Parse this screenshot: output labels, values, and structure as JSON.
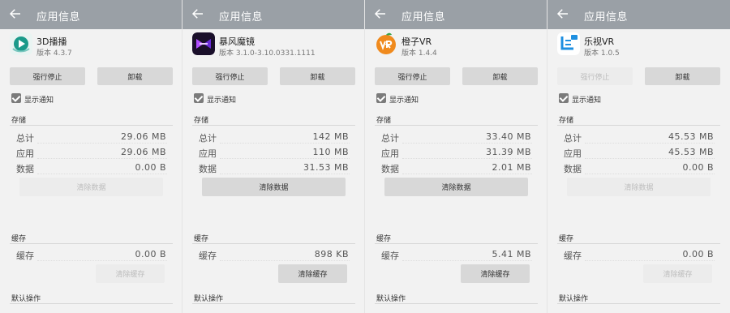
{
  "panels": [
    {
      "header_title": "应用信息",
      "app_name": "3D播播",
      "version": "版本 4.3.7",
      "icon_name": "3d-bobo-app-icon",
      "accent": "#1a9a8a",
      "force_stop": "强行停止",
      "uninstall": "卸载",
      "force_stop_enabled": true,
      "show_notifications": "显示通知",
      "storage_title": "存储",
      "rows": [
        {
          "label": "总计",
          "value": "29.06  MB"
        },
        {
          "label": "应用",
          "value": "29.06  MB"
        },
        {
          "label": "数据",
          "value": "0.00  B"
        }
      ],
      "clear_data": "清除数据",
      "clear_data_enabled": false,
      "cache_title": "缓存",
      "cache_label": "缓存",
      "cache_value": "0.00  B",
      "clear_cache": "清除缓存",
      "clear_cache_enabled": false,
      "default_title": "默认操作"
    },
    {
      "header_title": "应用信息",
      "app_name": "暴风魔镜",
      "version": "版本 3.1.0-3.10.0331.1111",
      "icon_name": "baofeng-mojing-app-icon",
      "accent": "#6a2bd9",
      "force_stop": "强行停止",
      "uninstall": "卸载",
      "force_stop_enabled": true,
      "show_notifications": "显示通知",
      "storage_title": "存储",
      "rows": [
        {
          "label": "总计",
          "value": "142  MB"
        },
        {
          "label": "应用",
          "value": "110  MB"
        },
        {
          "label": "数据",
          "value": "31.53  MB"
        }
      ],
      "clear_data": "清除数据",
      "clear_data_enabled": true,
      "cache_title": "缓存",
      "cache_label": "缓存",
      "cache_value": "898  KB",
      "clear_cache": "清除缓存",
      "clear_cache_enabled": true,
      "default_title": "默认操作"
    },
    {
      "header_title": "应用信息",
      "app_name": "橙子VR",
      "version": "版本 1.4.4",
      "icon_name": "chengzi-vr-app-icon",
      "accent": "#f08a1d",
      "force_stop": "强行停止",
      "uninstall": "卸载",
      "force_stop_enabled": true,
      "show_notifications": "显示通知",
      "storage_title": "存储",
      "rows": [
        {
          "label": "总计",
          "value": "33.40  MB"
        },
        {
          "label": "应用",
          "value": "31.39  MB"
        },
        {
          "label": "数据",
          "value": "2.01  MB"
        }
      ],
      "clear_data": "清除数据",
      "clear_data_enabled": true,
      "cache_title": "缓存",
      "cache_label": "缓存",
      "cache_value": "5.41  MB",
      "clear_cache": "清除缓存",
      "clear_cache_enabled": true,
      "default_title": "默认操作"
    },
    {
      "header_title": "应用信息",
      "app_name": "乐视VR",
      "version": "版本 1.0.5",
      "icon_name": "leshi-vr-app-icon",
      "accent": "#1e8fe0",
      "force_stop": "强行停止",
      "uninstall": "卸载",
      "force_stop_enabled": false,
      "show_notifications": "显示通知",
      "storage_title": "存储",
      "rows": [
        {
          "label": "总计",
          "value": "45.53  MB"
        },
        {
          "label": "应用",
          "value": "45.53  MB"
        },
        {
          "label": "数据",
          "value": "0.00  B"
        }
      ],
      "clear_data": "清除数据",
      "clear_data_enabled": false,
      "cache_title": "缓存",
      "cache_label": "缓存",
      "cache_value": "0.00  B",
      "clear_cache": "清除缓存",
      "clear_cache_enabled": false,
      "default_title": "默认操作"
    }
  ]
}
